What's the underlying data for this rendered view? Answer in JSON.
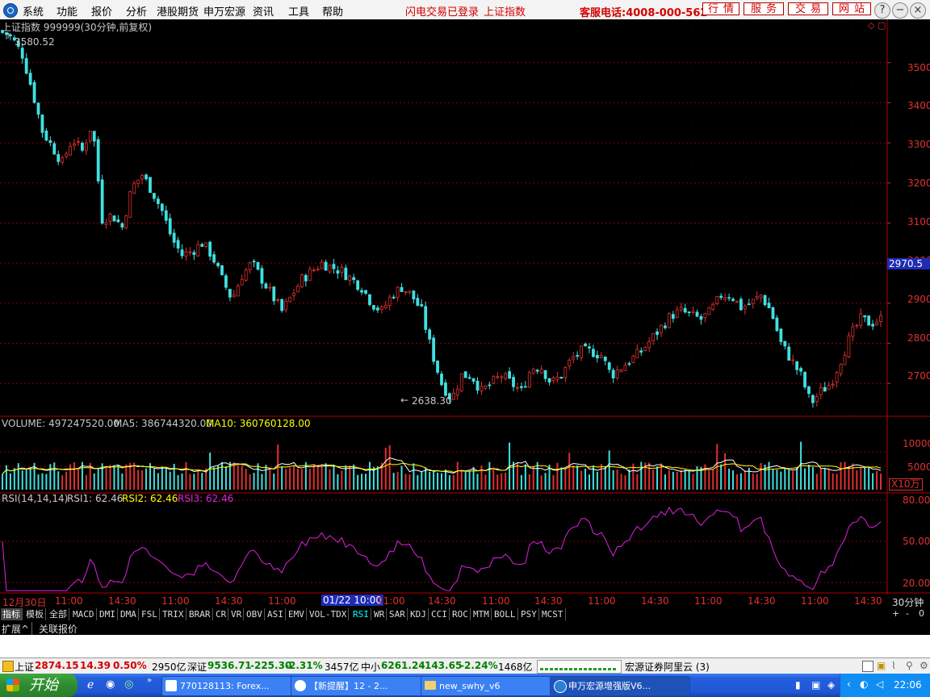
{
  "menubar": {
    "items": [
      "系统",
      "功能",
      "报价",
      "分析",
      "港股期货",
      "申万宏源",
      "资讯",
      "工具",
      "帮助"
    ],
    "flash_login": "闪电交易已登录",
    "index_name": "上证指数",
    "hotline": "客服电话:4008-000-562",
    "buttons": [
      "行情",
      "服务",
      "交易",
      "网站"
    ],
    "window_controls": [
      "?",
      "−",
      "×"
    ]
  },
  "chart_header": {
    "title": "上证指数 999999(30分钟,前复权)",
    "high_label": "3580.52",
    "low_label": "2638.30",
    "current_price_label": "2970.5"
  },
  "y_axis": {
    "ticks": [
      "3500",
      "3400",
      "3300",
      "3200",
      "3100",
      "3000",
      "2900",
      "2800",
      "2700"
    ]
  },
  "volume_panel": {
    "label": "VOLUME: 497247520.00",
    "ma5": "MA5: 386744320.00",
    "ma10": "MA10: 360760128.00",
    "ticks": [
      "10000",
      "5000"
    ],
    "unit": "X10万"
  },
  "rsi_panel": {
    "label": "RSI(14,14,14)",
    "rsi1": "RSI1: 62.46",
    "rsi2": "RSI2: 62.46",
    "rsi3": "RSI3: 62.46",
    "ticks": [
      "80.00",
      "50.00",
      "20.00"
    ]
  },
  "time_axis": {
    "labels": [
      "12月30日",
      "11:00",
      "14:30",
      "11:00",
      "14:30",
      "11:00",
      "01/22 10:00",
      "11:00",
      "14:30",
      "11:00",
      "14:30",
      "11:00",
      "14:30",
      "11:00",
      "14:30",
      "11:00",
      "14:30"
    ],
    "period": "30分钟"
  },
  "tabs": [
    "指标",
    "模板",
    "全部",
    "MACD",
    "DMI",
    "DMA",
    "FSL",
    "TRIX",
    "BRAR",
    "CR",
    "VR",
    "OBV",
    "ASI",
    "EMV",
    "VOL-TDX",
    "RSI",
    "WR",
    "SAR",
    "KDJ",
    "CCI",
    "ROC",
    "MTM",
    "BOLL",
    "PSY",
    "MCST"
  ],
  "tab_controls": [
    "+",
    "-",
    "0"
  ],
  "subtabs": [
    "扩展^",
    "关联报价"
  ],
  "status": {
    "sh_label": "上证",
    "sh_value": "2874.15",
    "sh_change": "14.39",
    "sh_pct": "0.50%",
    "sh_amount": "2950亿",
    "sz_label": "深证",
    "sz_value": "9536.71",
    "sz_change": "-225.30",
    "sz_pct": "-2.31%",
    "sz_amount": "3457亿",
    "zx_label": "中小",
    "zx_value": "6261.24",
    "zx_change": "-143.65",
    "zx_pct": "-2.24%",
    "zx_amount": "1468亿",
    "server": "宏源证券阿里云 (3)"
  },
  "taskbar": {
    "start": "开始",
    "tasks": [
      "770128113: Forex...",
      "【新提醒】12 - 2...",
      "new_swhy_v6",
      "申万宏源增强版V6..."
    ],
    "clock": "22:06"
  },
  "colors": {
    "up": "#e03030",
    "down": "#40e0e0",
    "ma5": "#ffffff",
    "ma10": "#ffff00",
    "rsi": "#e020e0",
    "grid": "#8b0000"
  },
  "chart_data": {
    "type": "candlestick",
    "ylim": [
      2620,
      3600
    ],
    "high": 3580.52,
    "low": 2638.3,
    "current": 2970.5,
    "close_path": [
      [
        0,
        3580
      ],
      [
        5,
        3560
      ],
      [
        10,
        3520
      ],
      [
        15,
        3430
      ],
      [
        20,
        3330
      ],
      [
        25,
        3290
      ],
      [
        30,
        3250
      ],
      [
        35,
        3310
      ],
      [
        40,
        3280
      ],
      [
        45,
        3350
      ],
      [
        50,
        3110
      ],
      [
        55,
        3120
      ],
      [
        60,
        3090
      ],
      [
        65,
        3190
      ],
      [
        70,
        3220
      ],
      [
        75,
        3180
      ],
      [
        80,
        3130
      ],
      [
        85,
        3060
      ],
      [
        90,
        3020
      ],
      [
        95,
        3030
      ],
      [
        100,
        3050
      ],
      [
        105,
        3020
      ],
      [
        110,
        2960
      ],
      [
        115,
        2910
      ],
      [
        120,
        2970
      ],
      [
        125,
        3000
      ],
      [
        130,
        2960
      ],
      [
        135,
        2920
      ],
      [
        140,
        2880
      ],
      [
        145,
        2920
      ],
      [
        150,
        2960
      ],
      [
        155,
        2980
      ],
      [
        160,
        3000
      ],
      [
        165,
        2990
      ],
      [
        170,
        2980
      ],
      [
        175,
        2960
      ],
      [
        180,
        2940
      ],
      [
        185,
        2900
      ],
      [
        190,
        2880
      ],
      [
        195,
        2920
      ],
      [
        200,
        2940
      ],
      [
        205,
        2920
      ],
      [
        210,
        2880
      ],
      [
        215,
        2780
      ],
      [
        220,
        2700
      ],
      [
        225,
        2660
      ],
      [
        230,
        2720
      ],
      [
        235,
        2720
      ],
      [
        240,
        2680
      ],
      [
        245,
        2700
      ],
      [
        250,
        2720
      ],
      [
        255,
        2700
      ],
      [
        260,
        2680
      ],
      [
        265,
        2740
      ],
      [
        270,
        2740
      ],
      [
        275,
        2700
      ],
      [
        280,
        2720
      ],
      [
        285,
        2760
      ],
      [
        290,
        2780
      ],
      [
        295,
        2780
      ],
      [
        300,
        2770
      ],
      [
        305,
        2720
      ],
      [
        310,
        2740
      ],
      [
        315,
        2760
      ],
      [
        320,
        2780
      ],
      [
        325,
        2810
      ],
      [
        330,
        2840
      ],
      [
        335,
        2870
      ],
      [
        340,
        2880
      ],
      [
        345,
        2870
      ],
      [
        350,
        2860
      ],
      [
        355,
        2880
      ],
      [
        360,
        2920
      ],
      [
        365,
        2920
      ],
      [
        370,
        2890
      ],
      [
        375,
        2900
      ],
      [
        380,
        2920
      ],
      [
        385,
        2880
      ],
      [
        390,
        2800
      ],
      [
        395,
        2760
      ],
      [
        400,
        2720
      ],
      [
        405,
        2650
      ],
      [
        410,
        2680
      ],
      [
        415,
        2700
      ],
      [
        420,
        2760
      ],
      [
        425,
        2820
      ],
      [
        430,
        2860
      ],
      [
        435,
        2850
      ],
      [
        440,
        2860
      ]
    ]
  }
}
